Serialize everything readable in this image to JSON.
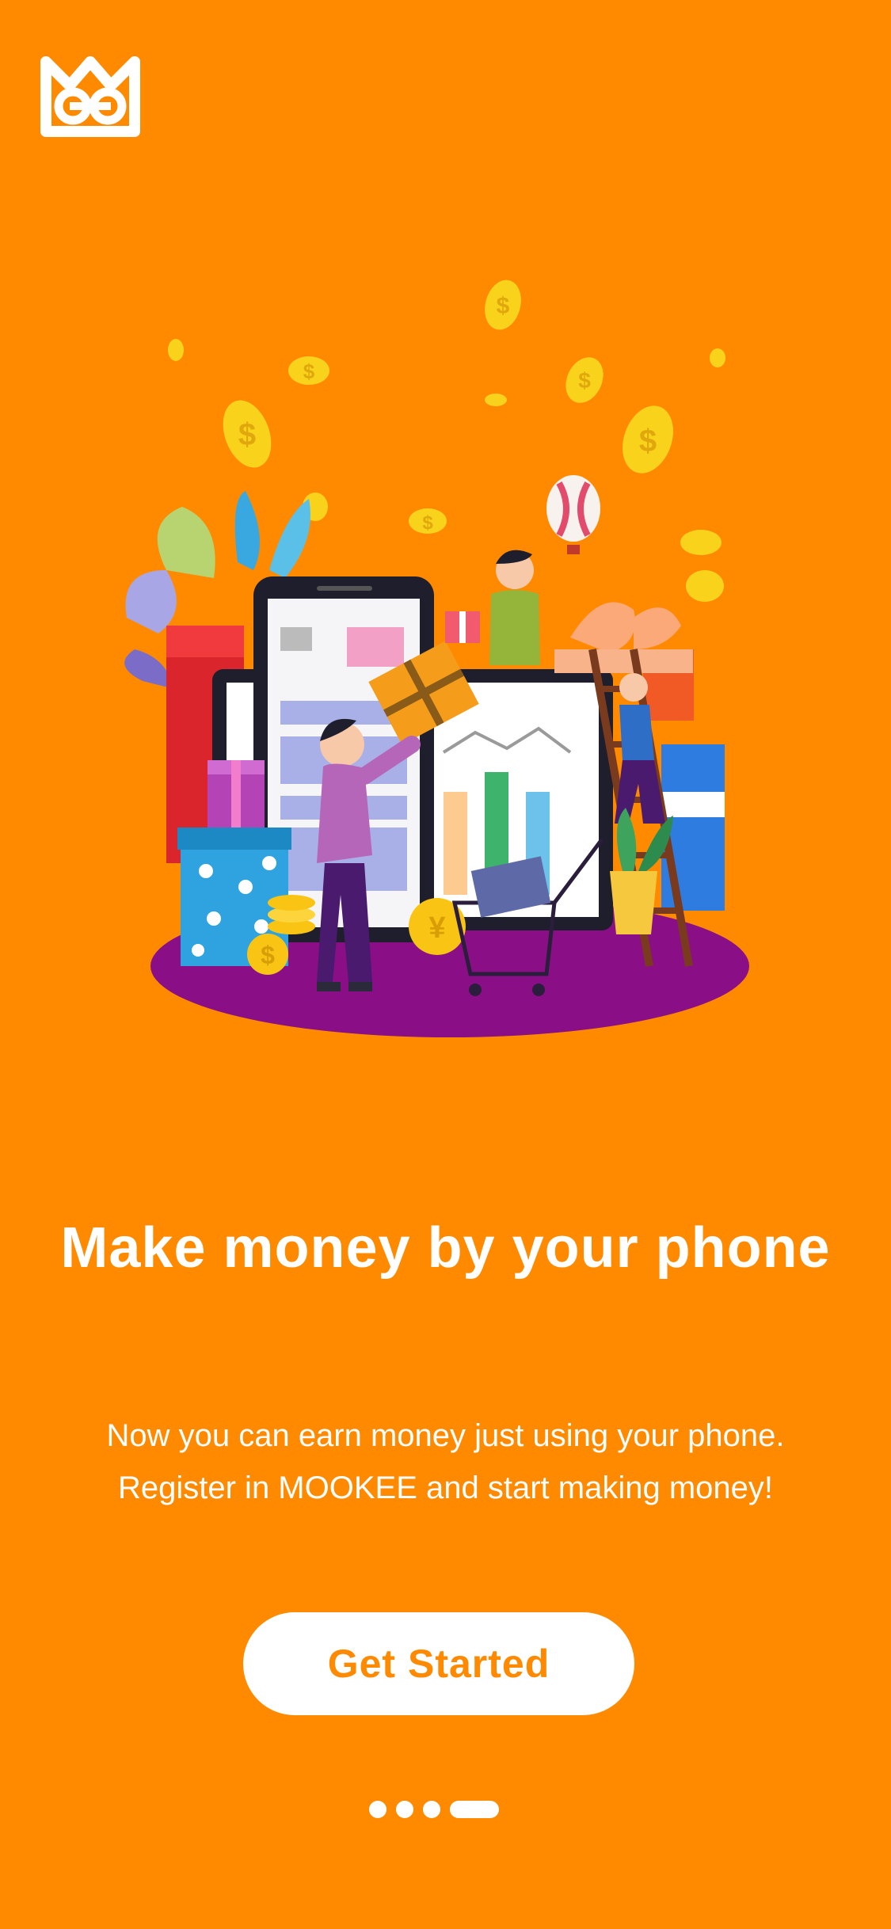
{
  "onboarding": {
    "headline": "Make money by your phone",
    "body_line1": "Now you can earn money just using your phone.",
    "body_line2": "Register in MOOKEE and start making money!",
    "cta_label": "Get Started",
    "pagination": {
      "total": 4,
      "current": 4
    }
  },
  "illustration": {
    "coin_symbol": "$",
    "yen_symbol": "¥"
  },
  "colors": {
    "background": "#FF8A00",
    "button_bg": "#FFFFFF",
    "button_text": "#FF8A00",
    "platform": "#8A0F86"
  },
  "icons": {
    "logo": "mookee-cat-logo-icon"
  }
}
